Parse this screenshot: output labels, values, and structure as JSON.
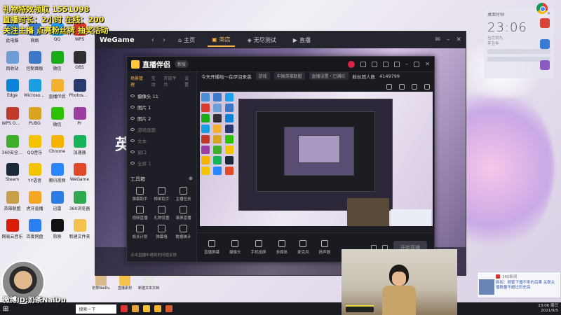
{
  "overlay": {
    "line1": "礼物特效领取 1551098",
    "line2": "直播时长：2小时 在线：200",
    "line3": "关注主播 点亮粉丝牌 抽奖活动"
  },
  "desktop_icons": [
    {
      "label": "此电脑",
      "color": "#4a90d9"
    },
    {
      "label": "网络",
      "color": "#3c7bd0"
    },
    {
      "label": "QQ",
      "color": "#1ea0f0"
    },
    {
      "label": "WPS",
      "color": "#d93a2b"
    },
    {
      "label": "回收站",
      "color": "#6d9fd6"
    },
    {
      "label": "控制面板",
      "color": "#3d78c8"
    },
    {
      "label": "微信",
      "color": "#1aad19"
    },
    {
      "label": "OBS",
      "color": "#302e31"
    },
    {
      "label": "Edge",
      "color": "#0a84d6"
    },
    {
      "label": "Microsoft Edge",
      "color": "#1b9de2"
    },
    {
      "label": "直播伴侣",
      "color": "#f2b230"
    },
    {
      "label": "Photoshop",
      "color": "#2a3a70"
    },
    {
      "label": "WPS Office",
      "color": "#c0392b"
    },
    {
      "label": "PUBG",
      "color": "#d9a521"
    },
    {
      "label": "微信",
      "color": "#2dc100"
    },
    {
      "label": "Pr",
      "color": "#9a3ea0"
    },
    {
      "label": "360安全卫士",
      "color": "#3fae29"
    },
    {
      "label": "QQ音乐",
      "color": "#f5c400"
    },
    {
      "label": "Chrome",
      "color": "#f4b400"
    },
    {
      "label": "加速器",
      "color": "#17b35b"
    },
    {
      "label": "Steam",
      "color": "#1b2838"
    },
    {
      "label": "YY语音",
      "color": "#f5c400"
    },
    {
      "label": "腾讯视频",
      "color": "#2a86ff"
    },
    {
      "label": "WeGame",
      "color": "#e04a2a"
    },
    {
      "label": "英雄联盟",
      "color": "#c9a04a"
    },
    {
      "label": "虎牙直播",
      "color": "#f5a623"
    },
    {
      "label": "迅雷",
      "color": "#2d7be5"
    },
    {
      "label": "360浏览器",
      "color": "#2fa84f"
    },
    {
      "label": "网易云音乐",
      "color": "#d81e06"
    },
    {
      "label": "百度网盘",
      "color": "#2b7ff2"
    },
    {
      "label": "剪映",
      "color": "#111111"
    },
    {
      "label": "新建文件夹",
      "color": "#f2c14e"
    }
  ],
  "launcher": {
    "brand": "WeGame",
    "tabs": [
      "主页",
      "商店",
      "无尽测试",
      "直播"
    ],
    "active_tab": "商店",
    "hero_text": "英"
  },
  "stream_app": {
    "brand": "直播伴侣",
    "version": "新版",
    "panel_tabs": [
      "场景管理",
      "互动",
      "开放平台",
      "设置"
    ],
    "scenes": [
      "摄像头 11",
      "图片 1",
      "图片 2",
      "游戏画面",
      "文本",
      "窗口",
      "全屏 1"
    ],
    "tools_title": "工具箱",
    "tools": [
      "弹幕助手",
      "榜单助手",
      "主播任务",
      "视频直播",
      "礼物设置",
      "录屏直播",
      "成长计划",
      "弹幕墙",
      "数据统计"
    ],
    "notice": "点击直播中遇到的问题反馈",
    "info": {
      "title": "今天开播啦～在伊沼来袭",
      "tag1": "游戏",
      "tag2": "中国英雄联盟",
      "sub1": "直播设置・已满栏",
      "sub2": "粉丝团人数",
      "sub3": "4149799"
    },
    "bottom_items": [
      "直播屏幕",
      "摄像头",
      "手机投屏",
      "多媒体",
      "麦克风",
      "扬声器"
    ],
    "live_button": "开始直播"
  },
  "widget": {
    "label": "桌面时钟",
    "time": "23:06",
    "date": "七月廿九",
    "sub": "辛丑年"
  },
  "weibo": "微博ID:奶茶NaiDu",
  "news": {
    "source": "360新闻",
    "body": "新闻：频繁下播不来的后果 关联主播数量不超过历史高"
  },
  "taskbar": {
    "search": "搜索一下",
    "time": "23:06 周日",
    "date": "2021/9/5"
  },
  "desk_files": [
    "奶茶NaiDu",
    "直播素材",
    "新建文本文档"
  ]
}
